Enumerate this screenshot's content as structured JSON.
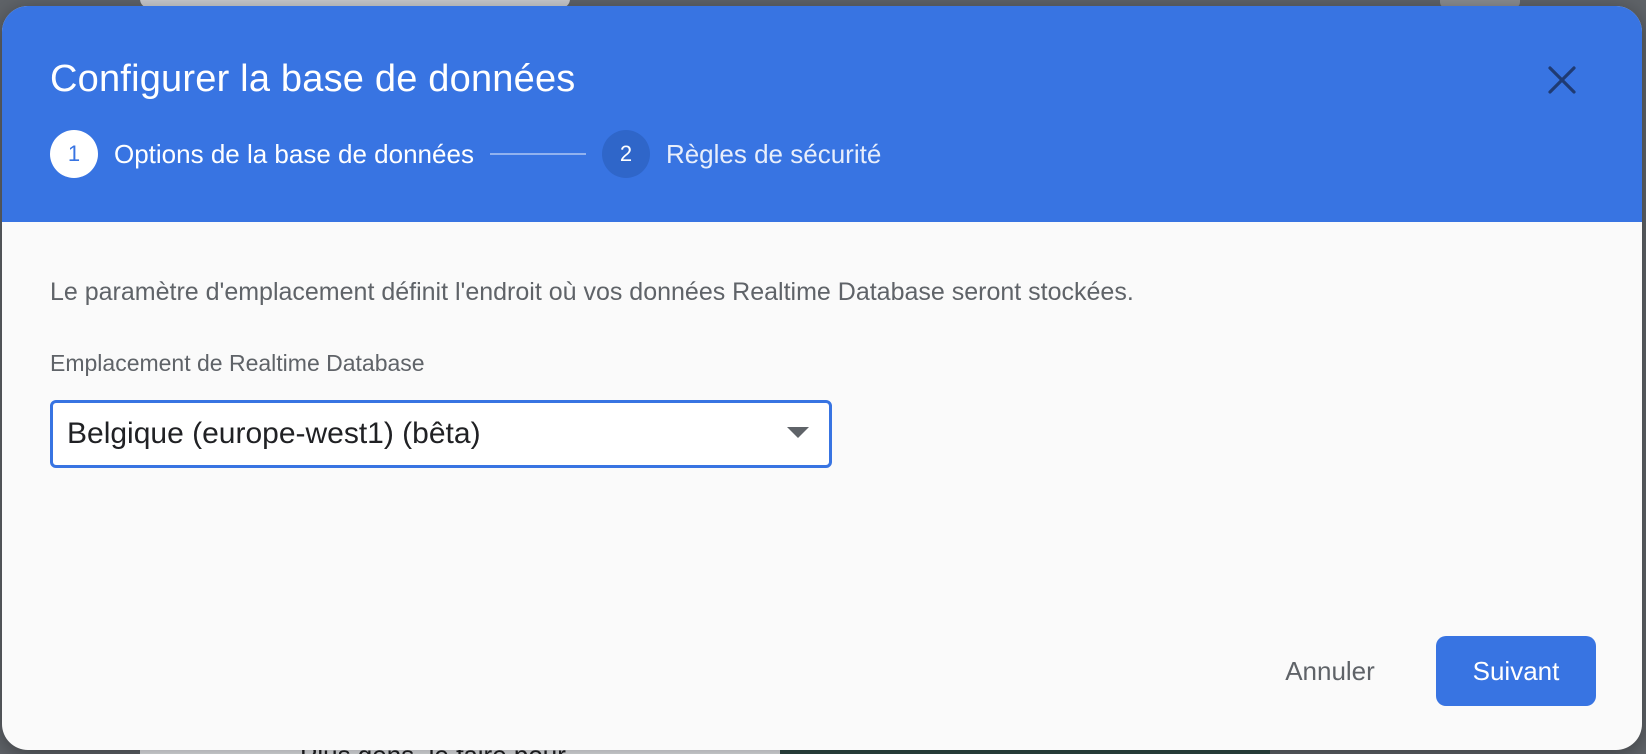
{
  "dialog": {
    "title": "Configurer la base de données",
    "close_icon": "close-icon"
  },
  "stepper": {
    "steps": [
      {
        "number": "1",
        "label": "Options de la base de données",
        "state": "active"
      },
      {
        "number": "2",
        "label": "Règles de sécurité",
        "state": "inactive"
      }
    ]
  },
  "body": {
    "description": "Le paramètre d'emplacement définit l'endroit où vos données Realtime Database seront stockées.",
    "location_label": "Emplacement de Realtime Database",
    "location_value": "Belgique (europe-west1) (bêta)"
  },
  "footer": {
    "cancel_label": "Annuler",
    "next_label": "Suivant"
  },
  "background": {
    "partial_text": "Plus gens, le faire pour"
  },
  "colors": {
    "header": "#3874e2",
    "accent": "#3874e2",
    "text_secondary": "#5f6368"
  }
}
